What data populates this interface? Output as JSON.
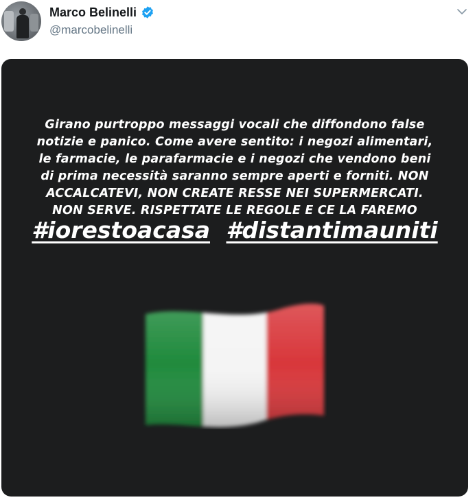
{
  "tweet": {
    "display_name": "Marco Belinelli",
    "handle": "@marcobelinelli",
    "verified": true,
    "icons": {
      "verified": "verified-badge-icon",
      "menu": "chevron-down-icon"
    },
    "colors": {
      "verified": "#1da1f2",
      "media_background": "#1c1d1e"
    }
  },
  "story": {
    "lines": [
      "Girano purtroppo messaggi vocali che diffondono false",
      "notizie e panico. Come avere sentito: i negozi alimentari,",
      "le farmacie, le parafarmacie e i negozi che vendono beni",
      "di prima necessità saranno sempre aperti e forniti. NON",
      "ACCALCATEVI, NON CREATE RESSE NEI SUPERMERCATI.",
      "NON SERVE. RISPETTATE LE REGOLE E CE LA FAREMO"
    ],
    "hashtags": [
      "#iorestoacasa",
      "#distantimauniti"
    ],
    "flag": {
      "name": "italy-flag-icon",
      "colors": [
        "#1f8a3c",
        "#f4f4f4",
        "#d8363a"
      ]
    }
  }
}
